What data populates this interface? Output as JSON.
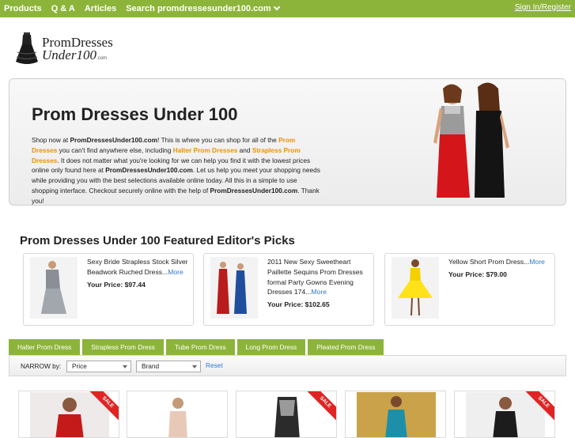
{
  "nav": {
    "items": [
      "Products",
      "Q & A",
      "Articles"
    ],
    "search_label": "Search promdressesunder100.com",
    "signin_label": "Sign In/Register"
  },
  "logo": {
    "line1": "PromDresses",
    "line2": "Under100",
    "suffix": ".com"
  },
  "hero": {
    "title": "Prom Dresses Under 100",
    "desc": {
      "p1": "Shop now at ",
      "site1": "PromDressesUnder100.com",
      "p2": "! This is where you can shop for all of the ",
      "link1": "Prom Dresses",
      "p3": " you can't find anywhere else, including ",
      "link2": "Halter Prom Dresses",
      "p4": " and ",
      "link3": "Strapless Prom Dresses",
      "p5": ". It does not matter what you're looking for we can help you find it with the lowest prices online only found here at ",
      "site2": "PromDressesUnder100.com",
      "p6": ". Let us help you meet your shopping needs while providing you with the best selections available online today. All this in a simple to use shopping interface. Checkout securely online with the help of ",
      "site3": "PromDressesUnder100.com",
      "p7": ". Thank you!"
    }
  },
  "featured": {
    "title": "Prom Dresses Under 100 Featured Editor's Picks",
    "price_label": "Your Price:",
    "more_label": "More",
    "items": [
      {
        "title": "Sexy Bride Strapless Stock Silver Beadwork Ruched Dress...",
        "price": "$97.44"
      },
      {
        "title": "2011 New Sexy Sweetheart Paillette Sequins Prom Dresses formal Party Gowns Evening Dresses 174...",
        "price": "$102.65"
      },
      {
        "title": "Yellow Short Prom Dress...",
        "price": "$79.00"
      }
    ]
  },
  "tabs": [
    "Halter Prom Dress",
    "Strapless Prom Dress",
    "Tube Prom Dress",
    "Long Prom Dress",
    "Pleated Prom Dress"
  ],
  "filter": {
    "narrow_label": "NARROW by:",
    "price": "Price",
    "brand": "Brand",
    "reset": "Reset"
  },
  "sale_label": "SALE",
  "colors": {
    "accent": "#8db43a",
    "orange": "#f09000",
    "link": "#2d78d0",
    "sale": "#e02424"
  }
}
